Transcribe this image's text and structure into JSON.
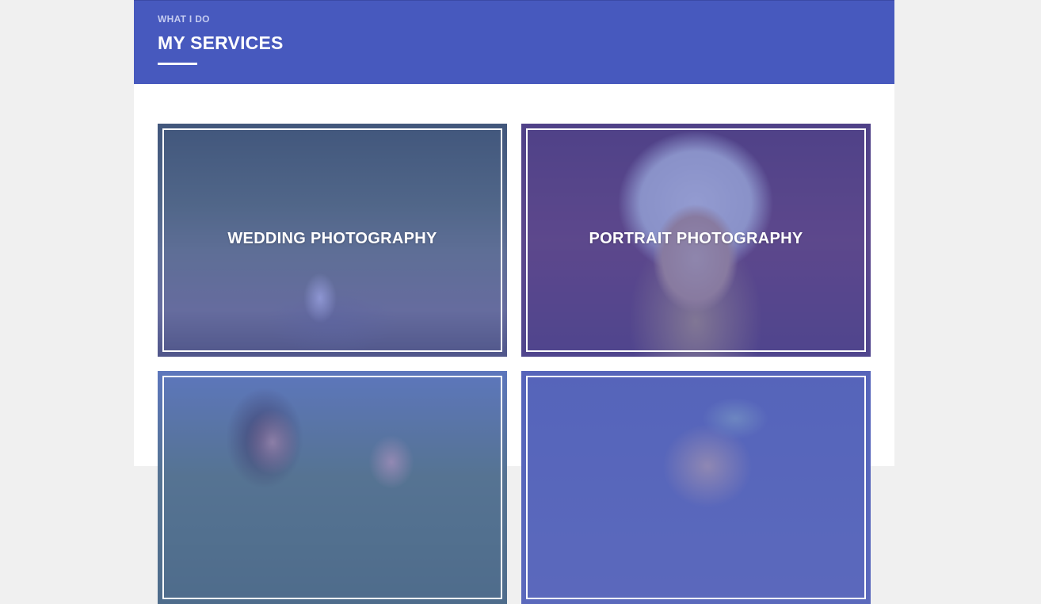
{
  "header": {
    "eyebrow": "WHAT I DO",
    "title": "MY SERVICES"
  },
  "services": [
    {
      "label": "WEDDING PHOTOGRAPHY"
    },
    {
      "label": "PORTRAIT PHOTOGRAPHY"
    },
    {
      "label": ""
    },
    {
      "label": ""
    }
  ],
  "colors": {
    "accent": "#4759be",
    "overlay": "rgba(70,84,178,0.55)",
    "page_background": "#f0f0f0",
    "content_background": "#ffffff"
  }
}
